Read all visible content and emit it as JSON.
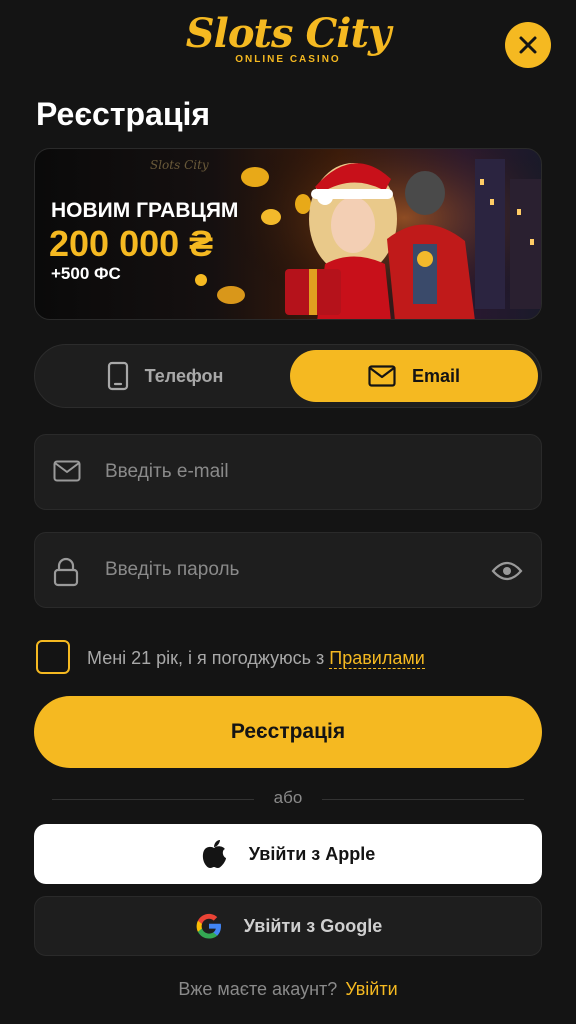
{
  "header": {
    "logo_main": "Slots City",
    "logo_sub": "ONLINE CASINO",
    "title": "Реєстрація"
  },
  "banner": {
    "line1": "НОВИМ ГРАВЦЯМ",
    "line2": "200 000 ₴",
    "line3": "+500 ФС",
    "mini_logo": "Slots City"
  },
  "tabs": [
    {
      "label": "Телефон",
      "icon": "phone-icon",
      "active": false
    },
    {
      "label": "Email",
      "icon": "mail-icon",
      "active": true
    }
  ],
  "form": {
    "email_placeholder": "Введіть e-mail",
    "password_placeholder": "Введіть пароль",
    "agree_text": "Мені 21 рік, і я погоджуюсь з",
    "rules_link": "Правилами",
    "submit_label": "Реєстрація"
  },
  "social": {
    "or_label": "або",
    "apple_label": "Увійти з Apple",
    "google_label": "Увійти з Google"
  },
  "footer": {
    "question": "Вже маєте акаунт?",
    "login_link": "Увійти"
  },
  "colors": {
    "accent": "#f5b921",
    "background": "#141414",
    "surface": "#1e1e1e"
  }
}
